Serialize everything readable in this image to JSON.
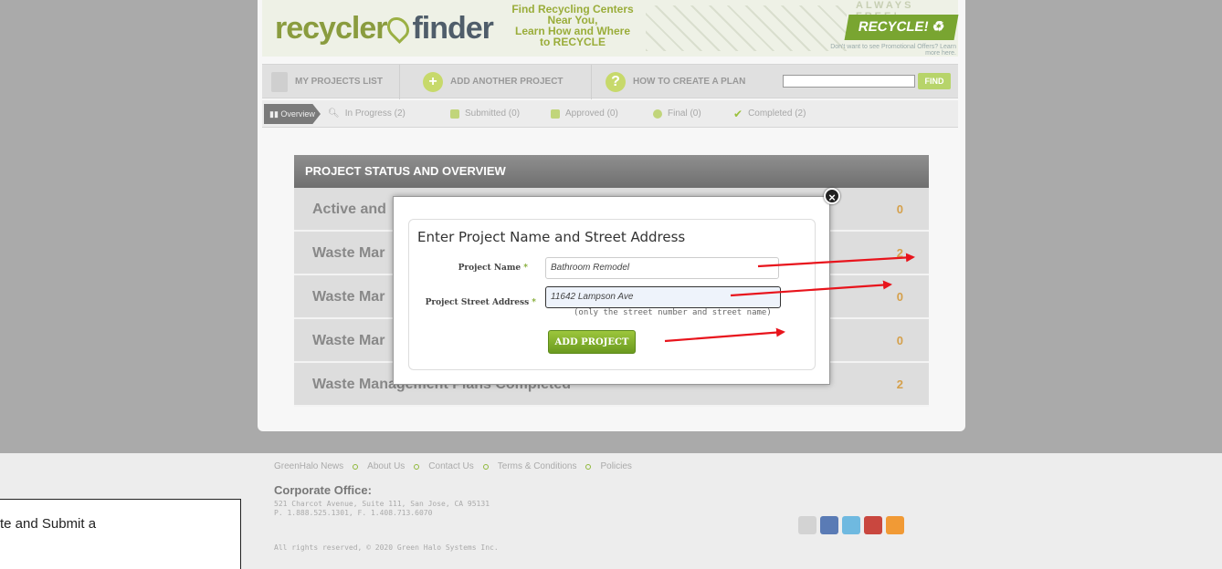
{
  "banner": {
    "logo_part1": "recycler",
    "logo_part2": "finder",
    "tagline": [
      "Find Recycling Centers Near You,",
      "Learn How and Where",
      "to RECYCLE"
    ],
    "always_free": "ALWAYS FREE!",
    "recycle_button": "RECYCLE! ♻",
    "promo_small": "Don't want to see Promotional Offers? Learn more here."
  },
  "nav": {
    "items": [
      {
        "label": "MY PROJECTS LIST"
      },
      {
        "label": "ADD ANOTHER PROJECT"
      },
      {
        "label": "HOW TO CREATE A PLAN"
      }
    ],
    "search_placeholder": "",
    "find_label": "FIND"
  },
  "tabs": [
    {
      "label": "Overview"
    },
    {
      "label": "In Progress (2)"
    },
    {
      "label": "Submitted (0)"
    },
    {
      "label": "Approved (0)"
    },
    {
      "label": "Final (0)"
    },
    {
      "label": "Completed (2)"
    }
  ],
  "status": {
    "heading": "PROJECT STATUS AND OVERVIEW",
    "rows": [
      {
        "label": "Active and",
        "count": "0"
      },
      {
        "label": "Waste Mar",
        "count": "2"
      },
      {
        "label": "Waste Mar",
        "count": "0"
      },
      {
        "label": "Waste Mar",
        "count": "0"
      },
      {
        "label": "Waste Management Plans Completed",
        "count": "2"
      }
    ]
  },
  "modal": {
    "title": "Enter Project Name and Street Address",
    "close": "×",
    "name_label": "Project Name",
    "name_value": "Bathroom Remodel",
    "address_label": "Project Street Address",
    "address_value": "11642 Lampson Ave",
    "address_hint": "(only the street number and street name)",
    "required_mark": "*",
    "add_button": "ADD PROJECT"
  },
  "footer": {
    "links": [
      "GreenHalo News",
      "About Us",
      "Contact Us",
      "Terms & Conditions",
      "Policies"
    ],
    "corp_title": "Corporate Office:",
    "address": "521 Charcot Avenue, Suite 111, San Jose, CA 95131",
    "phone": "P. 1.888.525.1301, F. 1.408.713.6070",
    "copyright": "All rights reserved, © 2020 Green Halo Systems Inc."
  },
  "social_icons": [
    "email-icon",
    "facebook-icon",
    "twitter-icon",
    "youtube-icon",
    "rss-icon"
  ],
  "callout": {
    "text": "te and Submit a"
  },
  "colors": {
    "accent_green": "#7ea82b",
    "arrow_red": "#e8141c",
    "count_orange": "#d5a04b"
  }
}
